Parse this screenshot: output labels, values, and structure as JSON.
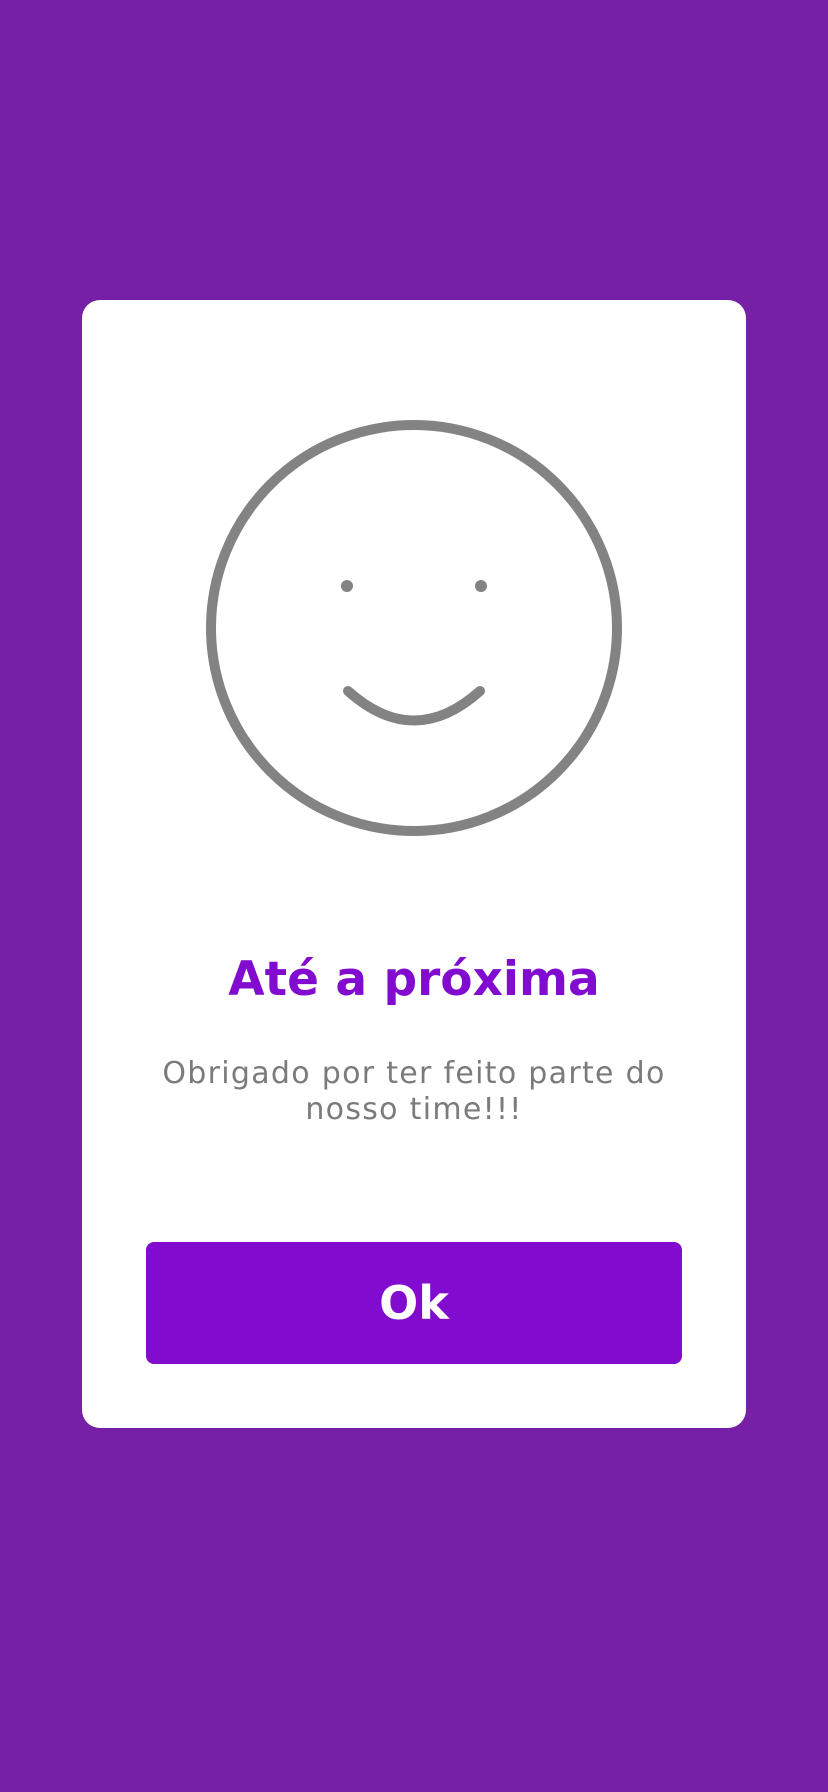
{
  "screen": {
    "background_color": "#7520a6"
  },
  "dialog": {
    "icon": "smiley-face-icon",
    "icon_color": "#838383",
    "title": "Até a próxima",
    "title_color": "#810bcf",
    "message": "Obrigado por ter feito parte do nosso time!!!",
    "message_color": "#7b7b7b",
    "ok_label": "Ok",
    "button_color": "#810bcf"
  }
}
